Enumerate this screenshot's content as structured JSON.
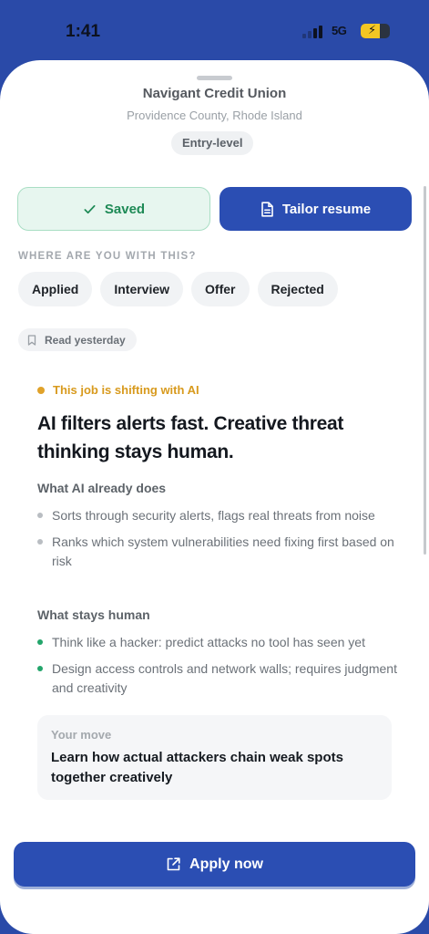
{
  "status_bar": {
    "time": "1:41",
    "network": "5G",
    "battery_level": 0.65
  },
  "job": {
    "company": "Navigant Credit Union",
    "location": "Providence County, Rhode Island",
    "level": "Entry-level"
  },
  "actions": {
    "saved_label": "Saved",
    "tailor_label": "Tailor resume"
  },
  "progress": {
    "label": "WHERE ARE YOU WITH THIS?",
    "options": [
      "Applied",
      "Interview",
      "Offer",
      "Rejected"
    ]
  },
  "read_status": "Read yesterday",
  "ai_insight": {
    "tag": "This job is shifting with AI",
    "headline": "AI filters alerts fast. Creative threat thinking stays human.",
    "ai_does_label": "What AI already does",
    "ai_does": [
      "Sorts through security alerts, flags real threats from noise",
      "Ranks which system vulnerabilities need fixing first based on risk"
    ],
    "human_label": "What stays human",
    "human": [
      "Think like a hacker: predict attacks no tool has seen yet",
      "Design access controls and network walls; requires judgment and creativity"
    ],
    "move_label": "Your move",
    "move_text": "Learn how actual attackers chain weak spots together creatively"
  },
  "apply_label": "Apply now",
  "colors": {
    "brand": "#2b4eb3",
    "saved_green": "#1e8a56",
    "ai_accent": "#d89a1d",
    "human_green": "#23a56b"
  }
}
